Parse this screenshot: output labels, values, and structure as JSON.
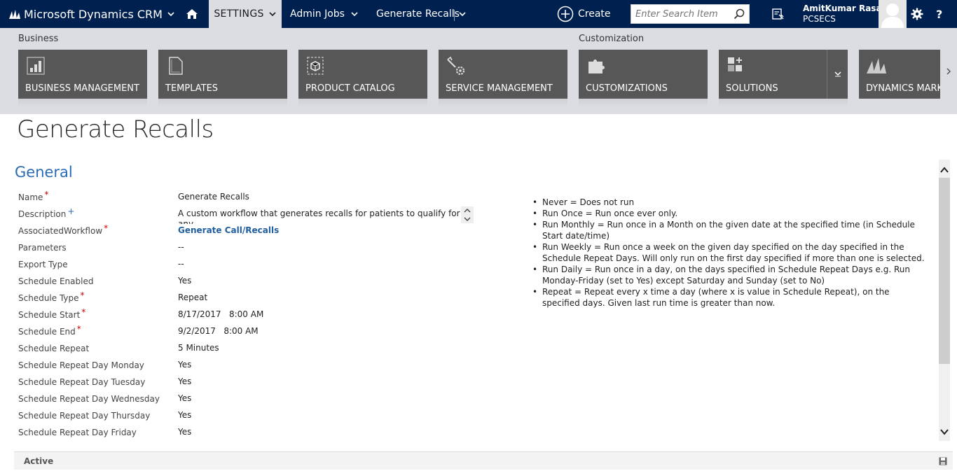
{
  "topbar": {
    "brand": "Microsoft Dynamics CRM",
    "settings_tab": "SETTINGS",
    "breadcrumb_1": "Admin Jobs",
    "breadcrumb_2": "Generate Recalls",
    "create_label": "Create",
    "search_placeholder": "Enter Search Item",
    "user_name": "AmitKumar Rasal",
    "user_org": "PCSECS",
    "help_label": "?"
  },
  "ribbon": {
    "groups": [
      "Business",
      "Customization"
    ],
    "tiles": [
      {
        "label": "BUSINESS MANAGEMENT",
        "icon": "business-management-icon"
      },
      {
        "label": "TEMPLATES",
        "icon": "templates-icon"
      },
      {
        "label": "PRODUCT CATALOG",
        "icon": "product-catalog-icon"
      },
      {
        "label": "SERVICE MANAGEMENT",
        "icon": "service-management-icon"
      },
      {
        "label": "CUSTOMIZATIONS",
        "icon": "customizations-icon"
      },
      {
        "label": "SOLUTIONS",
        "icon": "solutions-icon"
      },
      {
        "label": "DYNAMICS MARKE",
        "icon": "dynamics-marketplace-icon"
      }
    ]
  },
  "page": {
    "title": "Generate Recalls",
    "section": "General"
  },
  "form": {
    "fields": [
      {
        "label": "Name",
        "value": "Generate Recalls",
        "marker": "required"
      },
      {
        "label": "Description",
        "value": "A custom workflow that generates recalls for patients to qualify for any",
        "marker": "recommended"
      },
      {
        "label": "AssociatedWorkflow",
        "value": "Generate Call/Recalls",
        "marker": "required"
      },
      {
        "label": "Parameters",
        "value": "--",
        "marker": ""
      },
      {
        "label": "Export Type",
        "value": "--",
        "marker": ""
      },
      {
        "label": "Schedule Enabled",
        "value": "Yes",
        "marker": ""
      },
      {
        "label": "Schedule Type",
        "value": "Repeat",
        "marker": "required"
      },
      {
        "label": "Schedule Start",
        "value": "8/17/2017   8:00 AM",
        "marker": "required"
      },
      {
        "label": "Schedule End",
        "value": "9/2/2017   8:00 AM",
        "marker": "required"
      },
      {
        "label": "Schedule Repeat",
        "value": "5 Minutes",
        "marker": ""
      },
      {
        "label": "Schedule Repeat Day Monday",
        "value": "Yes",
        "marker": ""
      },
      {
        "label": "Schedule Repeat Day Tuesday",
        "value": "Yes",
        "marker": ""
      },
      {
        "label": "Schedule Repeat Day Wednesday",
        "value": "Yes",
        "marker": ""
      },
      {
        "label": "Schedule Repeat Day Thursday",
        "value": "Yes",
        "marker": ""
      },
      {
        "label": "Schedule Repeat Day Friday",
        "value": "Yes",
        "marker": ""
      }
    ],
    "required_marker": "*",
    "recommended_marker": "+"
  },
  "help_notes": [
    "Never = Does not run",
    "Run Once = Run once ever only.",
    "Run Monthly = Run once in a Month on the given date at the specified time (in Schedule Start date/time)",
    "Run Weekly = Run once a week on the given day specified on the day specified in the Schedule Repeat Days. Will only run on the first day specified if more than one is selected.",
    "Run Daily = Run once in a day, on the days specified in Schedule Repeat Days e.g. Run Monday-Friday (set to Yes) except Saturday and Sunday (set to No)",
    "Repeat = Repeat every x time a day (where x is value in Schedule Repeat), on the specified days. Given last run time is greater than now."
  ],
  "status": {
    "text": "Active"
  },
  "colors": {
    "nav_bg": "#002050",
    "ribbon_bg": "#dcdde3",
    "tile_bg": "#575757",
    "link": "#1f5f9f",
    "required": "#cc0000"
  }
}
